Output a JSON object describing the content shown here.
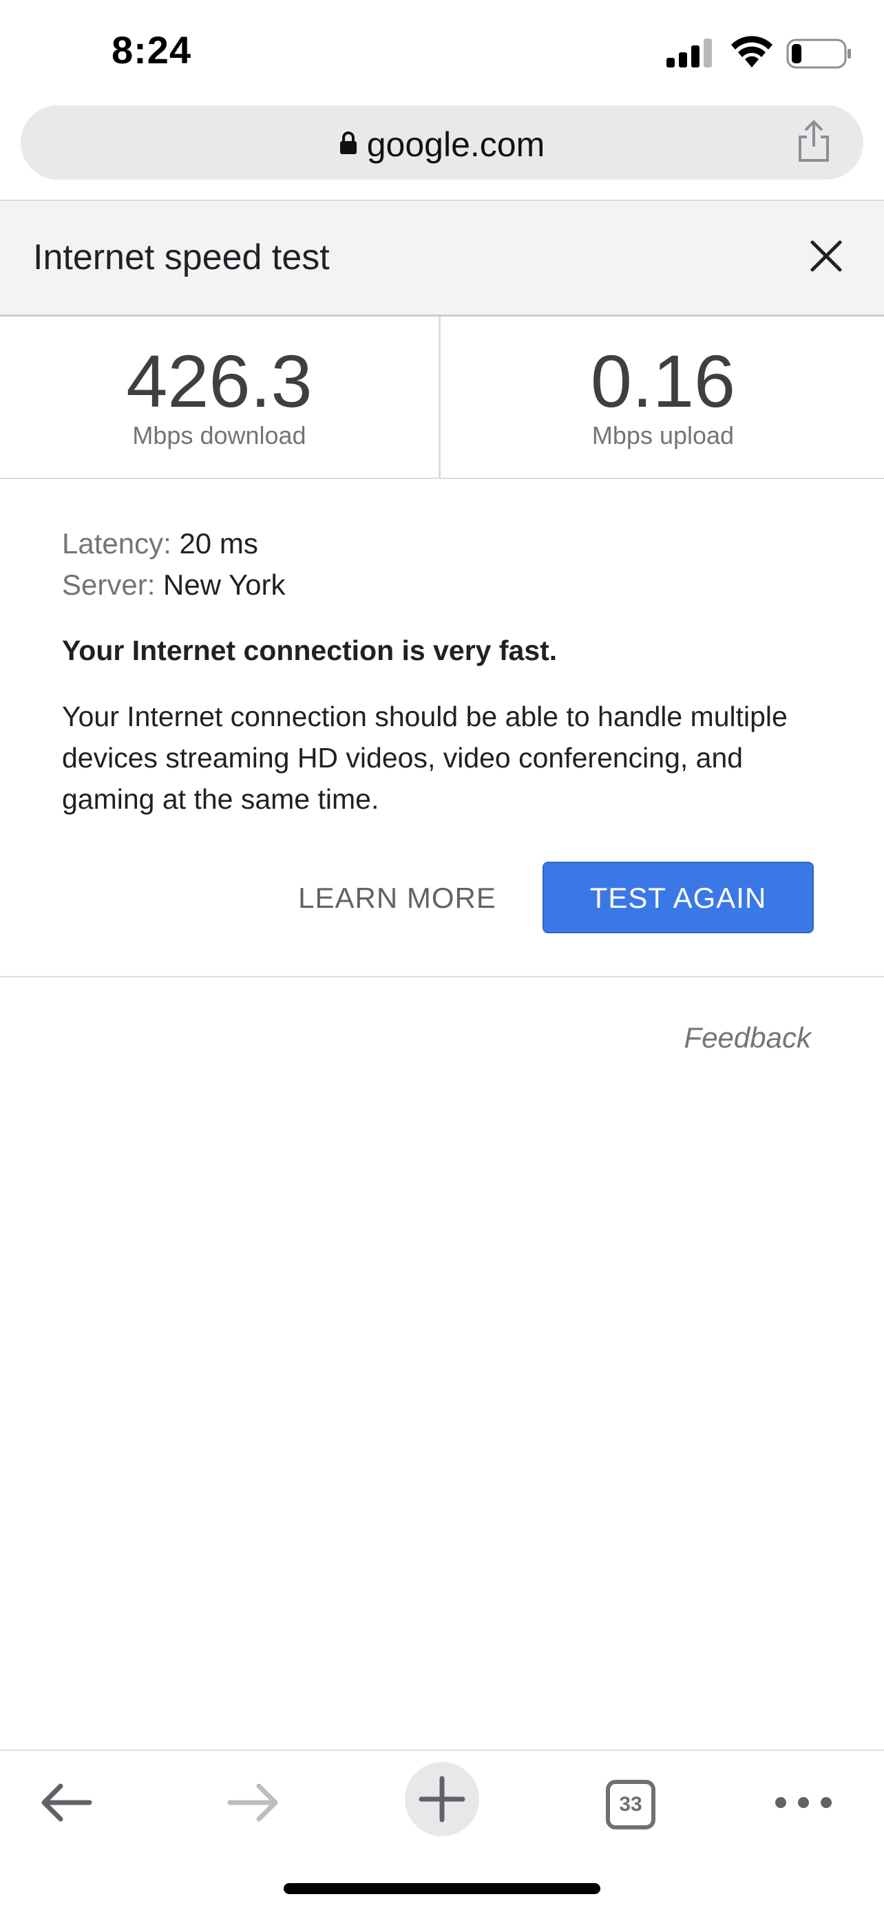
{
  "status_bar": {
    "time": "8:24",
    "icons": [
      "signal-icon",
      "wifi-icon",
      "battery-icon"
    ]
  },
  "browser": {
    "url": "google.com",
    "lock_icon": "lock-icon",
    "share_icon": "share-icon"
  },
  "panel": {
    "title": "Internet speed test",
    "close_icon": "close-icon"
  },
  "results": {
    "download": {
      "value": "426.3",
      "unit": "Mbps download"
    },
    "upload": {
      "value": "0.16",
      "unit": "Mbps upload"
    }
  },
  "details": {
    "latency_label": "Latency:",
    "latency_value": "20 ms",
    "server_label": "Server:",
    "server_value": "New York",
    "headline": "Your Internet connection is very fast.",
    "description": "Your Internet connection should be able to handle multiple devices streaming HD videos, video conferencing, and gaming at the same time."
  },
  "actions": {
    "learn_more": "LEARN MORE",
    "test_again": "TEST AGAIN",
    "feedback": "Feedback"
  },
  "toolbar": {
    "tab_count": "33",
    "icons": [
      "back-arrow-icon",
      "forward-arrow-icon",
      "plus-icon",
      "tabs-icon",
      "more-icon"
    ]
  },
  "colors": {
    "primary_button": "#3b78e7",
    "panel_header_bg": "#f1f3f4",
    "url_bar_bg": "#e9e9eb"
  }
}
